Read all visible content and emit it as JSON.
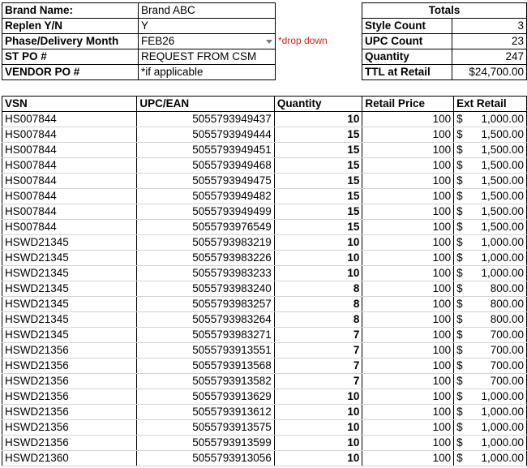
{
  "info": [
    {
      "label": "Brand Name:",
      "value": "Brand ABC"
    },
    {
      "label": "Replen Y/N",
      "value": "Y"
    },
    {
      "label": "Phase/Delivery Month",
      "value": "FEB26",
      "dropdown": true
    },
    {
      "label": "ST PO #",
      "value": "REQUEST FROM CSM"
    },
    {
      "label": "VENDOR PO #",
      "value": "*if applicable"
    }
  ],
  "dropdown_note": "*drop down",
  "totals": {
    "title": "Totals",
    "rows": [
      {
        "label": "Style Count",
        "value": "3"
      },
      {
        "label": "UPC Count",
        "value": "23"
      },
      {
        "label": "Quantity",
        "value": "247"
      },
      {
        "label": "TTL at Retail",
        "value": "$24,700.00"
      }
    ]
  },
  "table": {
    "headers": [
      "VSN",
      "UPC/EAN",
      "Quantity",
      "Retail Price",
      "Ext Retail"
    ],
    "rows": [
      [
        "HS007844",
        "5055793949437",
        "10",
        "100",
        "$",
        "1,000.00"
      ],
      [
        "HS007844",
        "5055793949444",
        "15",
        "100",
        "$",
        "1,500.00"
      ],
      [
        "HS007844",
        "5055793949451",
        "15",
        "100",
        "$",
        "1,500.00"
      ],
      [
        "HS007844",
        "5055793949468",
        "15",
        "100",
        "$",
        "1,500.00"
      ],
      [
        "HS007844",
        "5055793949475",
        "15",
        "100",
        "$",
        "1,500.00"
      ],
      [
        "HS007844",
        "5055793949482",
        "15",
        "100",
        "$",
        "1,500.00"
      ],
      [
        "HS007844",
        "5055793949499",
        "15",
        "100",
        "$",
        "1,500.00"
      ],
      [
        "HS007844",
        "5055793976549",
        "15",
        "100",
        "$",
        "1,500.00"
      ],
      [
        "HSWD21345",
        "5055793983219",
        "10",
        "100",
        "$",
        "1,000.00"
      ],
      [
        "HSWD21345",
        "5055793983226",
        "10",
        "100",
        "$",
        "1,000.00"
      ],
      [
        "HSWD21345",
        "5055793983233",
        "10",
        "100",
        "$",
        "1,000.00"
      ],
      [
        "HSWD21345",
        "5055793983240",
        "8",
        "100",
        "$",
        "800.00"
      ],
      [
        "HSWD21345",
        "5055793983257",
        "8",
        "100",
        "$",
        "800.00"
      ],
      [
        "HSWD21345",
        "5055793983264",
        "8",
        "100",
        "$",
        "800.00"
      ],
      [
        "HSWD21345",
        "5055793983271",
        "7",
        "100",
        "$",
        "700.00"
      ],
      [
        "HSWD21356",
        "5055793913551",
        "7",
        "100",
        "$",
        "700.00"
      ],
      [
        "HSWD21356",
        "5055793913568",
        "7",
        "100",
        "$",
        "700.00"
      ],
      [
        "HSWD21356",
        "5055793913582",
        "7",
        "100",
        "$",
        "700.00"
      ],
      [
        "HSWD21356",
        "5055793913629",
        "10",
        "100",
        "$",
        "1,000.00"
      ],
      [
        "HSWD21356",
        "5055793913612",
        "10",
        "100",
        "$",
        "1,000.00"
      ],
      [
        "HSWD21356",
        "5055793913575",
        "10",
        "100",
        "$",
        "1,000.00"
      ],
      [
        "HSWD21356",
        "5055793913599",
        "10",
        "100",
        "$",
        "1,000.00"
      ],
      [
        "HSWD21360",
        "5055793913056",
        "10",
        "100",
        "$",
        "1,000.00"
      ]
    ]
  }
}
